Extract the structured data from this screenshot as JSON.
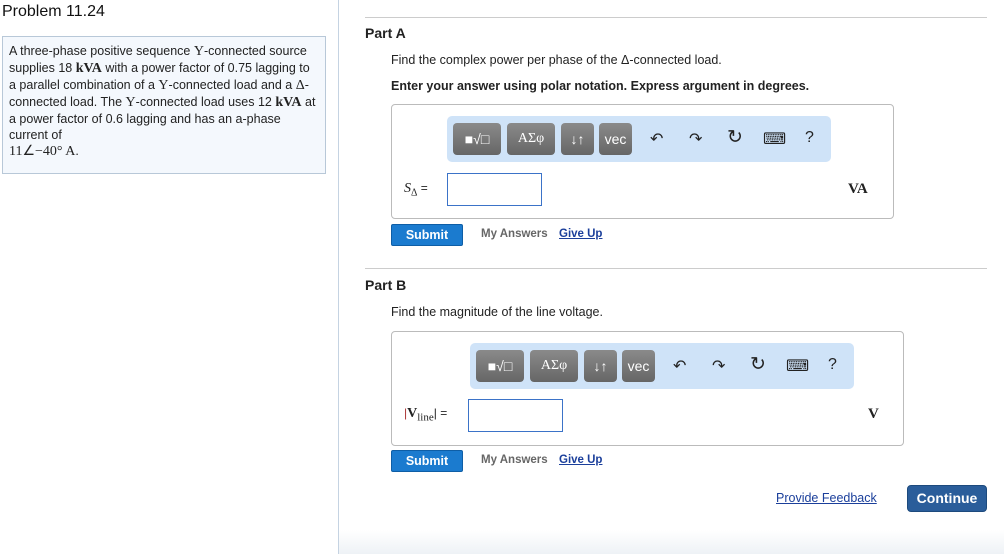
{
  "problem": {
    "title": "Problem 11.24",
    "statement": [
      "A three-phase positive sequence ",
      "Y",
      "-connected source supplies 18 ",
      "kVA",
      " with a power factor of 0.75 lagging to a parallel combination of a ",
      "Y",
      "-connected load and a ",
      "Δ",
      "-connected load. The ",
      "Y",
      "-connected load uses 12 ",
      "kVA",
      " at a power factor of 0.6 lagging and has an a-phase current of ",
      "11∠−40° A",
      "."
    ]
  },
  "toolbar": {
    "template": "■√□",
    "greek": "ΑΣφ",
    "arrows": "↓↑",
    "vec": "vec",
    "undo": "↶",
    "redo": "↷",
    "reset": "↻",
    "keyboard": "⌨",
    "help": "?"
  },
  "partA": {
    "label": "Part A",
    "question": "Find the complex power per phase of the Δ-connected load.",
    "instruction": "Enter your answer using polar notation. Express argument in degrees.",
    "var": "S",
    "sub": "Δ",
    "eq": " =",
    "value": "",
    "unit": "VA",
    "submit": "Submit",
    "my_answers": "My Answers",
    "give_up": "Give Up"
  },
  "partB": {
    "label": "Part B",
    "question": "Find the magnitude of the line voltage.",
    "var": "V",
    "sub": "line",
    "eq": " =",
    "value": "",
    "unit": "V",
    "submit": "Submit",
    "my_answers": "My Answers",
    "give_up": "Give Up"
  },
  "footer": {
    "feedback": "Provide Feedback",
    "continue": "Continue"
  }
}
